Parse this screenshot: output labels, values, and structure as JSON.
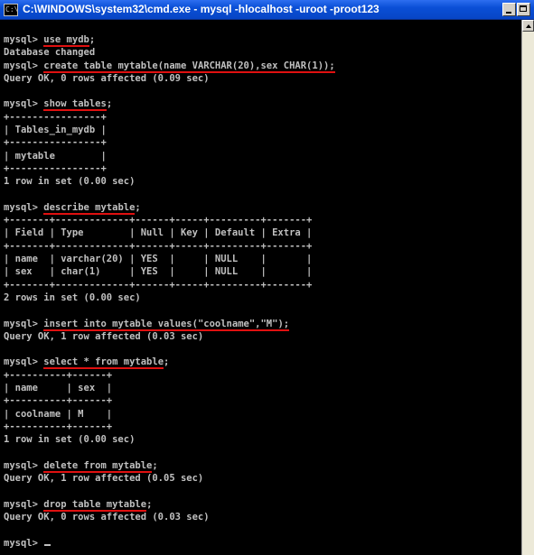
{
  "window": {
    "title": "C:\\WINDOWS\\system32\\cmd.exe - mysql -hlocalhost -uroot -proot123",
    "icon_label": "C:\\"
  },
  "console": {
    "lines": [
      {
        "prompt": "mysql> ",
        "cmd": "use mydb",
        "after": ";"
      },
      {
        "text": "Database changed"
      },
      {
        "prompt": "mysql> ",
        "cmd": "create table mytable(name VARCHAR(20),sex CHAR(1));",
        "after": ""
      },
      {
        "text": "Query OK, 0 rows affected (0.09 sec)"
      },
      {
        "text": ""
      },
      {
        "prompt": "mysql> ",
        "cmd": "show tables",
        "after": ";"
      },
      {
        "text": "+----------------+"
      },
      {
        "text": "| Tables_in_mydb |"
      },
      {
        "text": "+----------------+"
      },
      {
        "text": "| mytable        |"
      },
      {
        "text": "+----------------+"
      },
      {
        "text": "1 row in set (0.00 sec)"
      },
      {
        "text": ""
      },
      {
        "prompt": "mysql> ",
        "cmd": "describe mytable",
        "after": ";"
      },
      {
        "text": "+-------+-------------+------+-----+---------+-------+"
      },
      {
        "text": "| Field | Type        | Null | Key | Default | Extra |"
      },
      {
        "text": "+-------+-------------+------+-----+---------+-------+"
      },
      {
        "text": "| name  | varchar(20) | YES  |     | NULL    |       |"
      },
      {
        "text": "| sex   | char(1)     | YES  |     | NULL    |       |"
      },
      {
        "text": "+-------+-------------+------+-----+---------+-------+"
      },
      {
        "text": "2 rows in set (0.00 sec)"
      },
      {
        "text": ""
      },
      {
        "prompt": "mysql> ",
        "cmd": "insert into mytable values(\"coolname\",\"M\");",
        "after": ""
      },
      {
        "text": "Query OK, 1 row affected (0.03 sec)"
      },
      {
        "text": ""
      },
      {
        "prompt": "mysql> ",
        "cmd": "select * from mytable",
        "after": ";"
      },
      {
        "text": "+----------+------+"
      },
      {
        "text": "| name     | sex  |"
      },
      {
        "text": "+----------+------+"
      },
      {
        "text": "| coolname | M    |"
      },
      {
        "text": "+----------+------+"
      },
      {
        "text": "1 row in set (0.00 sec)"
      },
      {
        "text": ""
      },
      {
        "prompt": "mysql> ",
        "cmd": "delete from mytable",
        "after": ";"
      },
      {
        "text": "Query OK, 1 row affected (0.05 sec)"
      },
      {
        "text": ""
      },
      {
        "prompt": "mysql> ",
        "cmd": "drop table mytable",
        "after": ";"
      },
      {
        "text": "Query OK, 0 rows affected (0.03 sec)"
      },
      {
        "text": ""
      },
      {
        "prompt": "mysql> ",
        "cmd": "",
        "after": "",
        "cursor": true
      }
    ]
  },
  "colors": {
    "console_bg": "#000000",
    "console_text": "#c0c0c0",
    "highlight_underline": "#e01010",
    "titlebar": "#0a4fd6"
  }
}
